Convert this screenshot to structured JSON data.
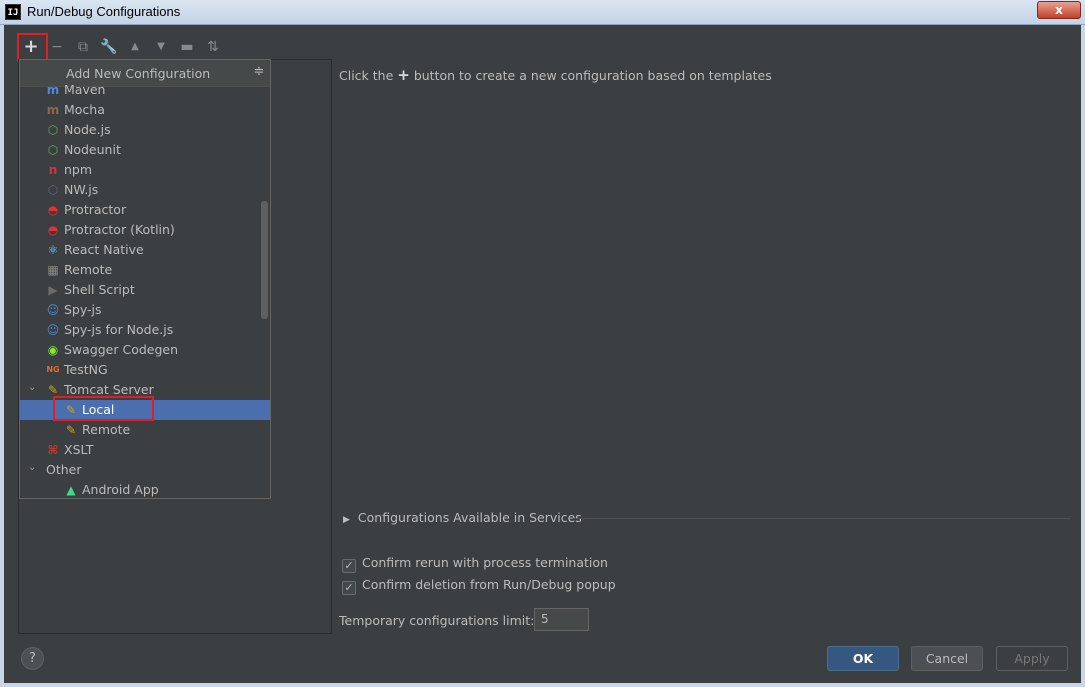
{
  "window": {
    "title": "Run/Debug Configurations",
    "close_glyph": "x",
    "app_icon_text": "IJ"
  },
  "toolbar": {
    "add": "+",
    "remove": "−",
    "copy": "⧉",
    "edit": "🔧",
    "up": "▲",
    "down": "▼",
    "folder": "▬",
    "sort": "⇅"
  },
  "popup": {
    "title": "Add New Configuration",
    "items": [
      {
        "label": "Maven",
        "icon": "maven-icon",
        "color": "#4a89dc",
        "glyph": "m"
      },
      {
        "label": "Mocha",
        "icon": "mocha-icon",
        "color": "#8d6748",
        "glyph": "m"
      },
      {
        "label": "Node.js",
        "icon": "nodejs-icon",
        "color": "#6aa84f",
        "glyph": "⬡"
      },
      {
        "label": "Nodeunit",
        "icon": "nodeunit-icon",
        "color": "#6aa84f",
        "glyph": "⬡"
      },
      {
        "label": "npm",
        "icon": "npm-icon",
        "color": "#cb3837",
        "glyph": "n"
      },
      {
        "label": "NW.js",
        "icon": "nwjs-icon",
        "color": "#5a6a7a",
        "glyph": "⬡"
      },
      {
        "label": "Protractor",
        "icon": "protractor-icon",
        "color": "#e23237",
        "glyph": "◓"
      },
      {
        "label": "Protractor (Kotlin)",
        "icon": "protractor-kotlin-icon",
        "color": "#e23237",
        "glyph": "◓"
      },
      {
        "label": "React Native",
        "icon": "react-icon",
        "color": "#61dafb",
        "glyph": "⚛"
      },
      {
        "label": "Remote",
        "icon": "remote-icon",
        "color": "#8a8a8a",
        "glyph": "▦"
      },
      {
        "label": "Shell Script",
        "icon": "shell-script-icon",
        "color": "#6b6b6b",
        "glyph": "▶"
      },
      {
        "label": "Spy-js",
        "icon": "spy-js-icon",
        "color": "#4a89dc",
        "glyph": "☺"
      },
      {
        "label": "Spy-js for Node.js",
        "icon": "spy-js-node-icon",
        "color": "#4a89dc",
        "glyph": "☺"
      },
      {
        "label": "Swagger Codegen",
        "icon": "swagger-icon",
        "color": "#85ea2d",
        "glyph": "◉"
      },
      {
        "label": "TestNG",
        "icon": "testng-icon",
        "color": "#e06c2a",
        "glyph": "NG"
      },
      {
        "label": "Tomcat Server",
        "icon": "tomcat-icon",
        "color": "#d9a400",
        "glyph": "✎",
        "expanded": true
      },
      {
        "label": "Local",
        "icon": "tomcat-local-icon",
        "color": "#d9a400",
        "glyph": "✎",
        "child": true,
        "selected": true
      },
      {
        "label": "Remote",
        "icon": "tomcat-remote-icon",
        "color": "#d9a400",
        "glyph": "✎",
        "child": true
      },
      {
        "label": "XSLT",
        "icon": "xslt-icon",
        "color": "#c0392b",
        "glyph": "⌘"
      },
      {
        "label": "Other",
        "icon": "",
        "color": "",
        "glyph": "",
        "group": true,
        "expanded": true
      },
      {
        "label": "Android App",
        "icon": "android-icon",
        "color": "#3ddc84",
        "glyph": "▲",
        "child": true
      }
    ]
  },
  "main": {
    "hint_prefix": "Click the",
    "hint_plus": "+",
    "hint_suffix": "button to create a new configuration based on templates",
    "services_label": "Configurations Available in Services",
    "confirm_rerun": "Confirm rerun with process termination",
    "confirm_deletion": "Confirm deletion from Run/Debug popup",
    "temp_limit_label": "Temporary configurations limit:",
    "temp_limit_value": "5"
  },
  "footer": {
    "help": "?",
    "ok": "OK",
    "cancel": "Cancel",
    "apply": "Apply"
  }
}
